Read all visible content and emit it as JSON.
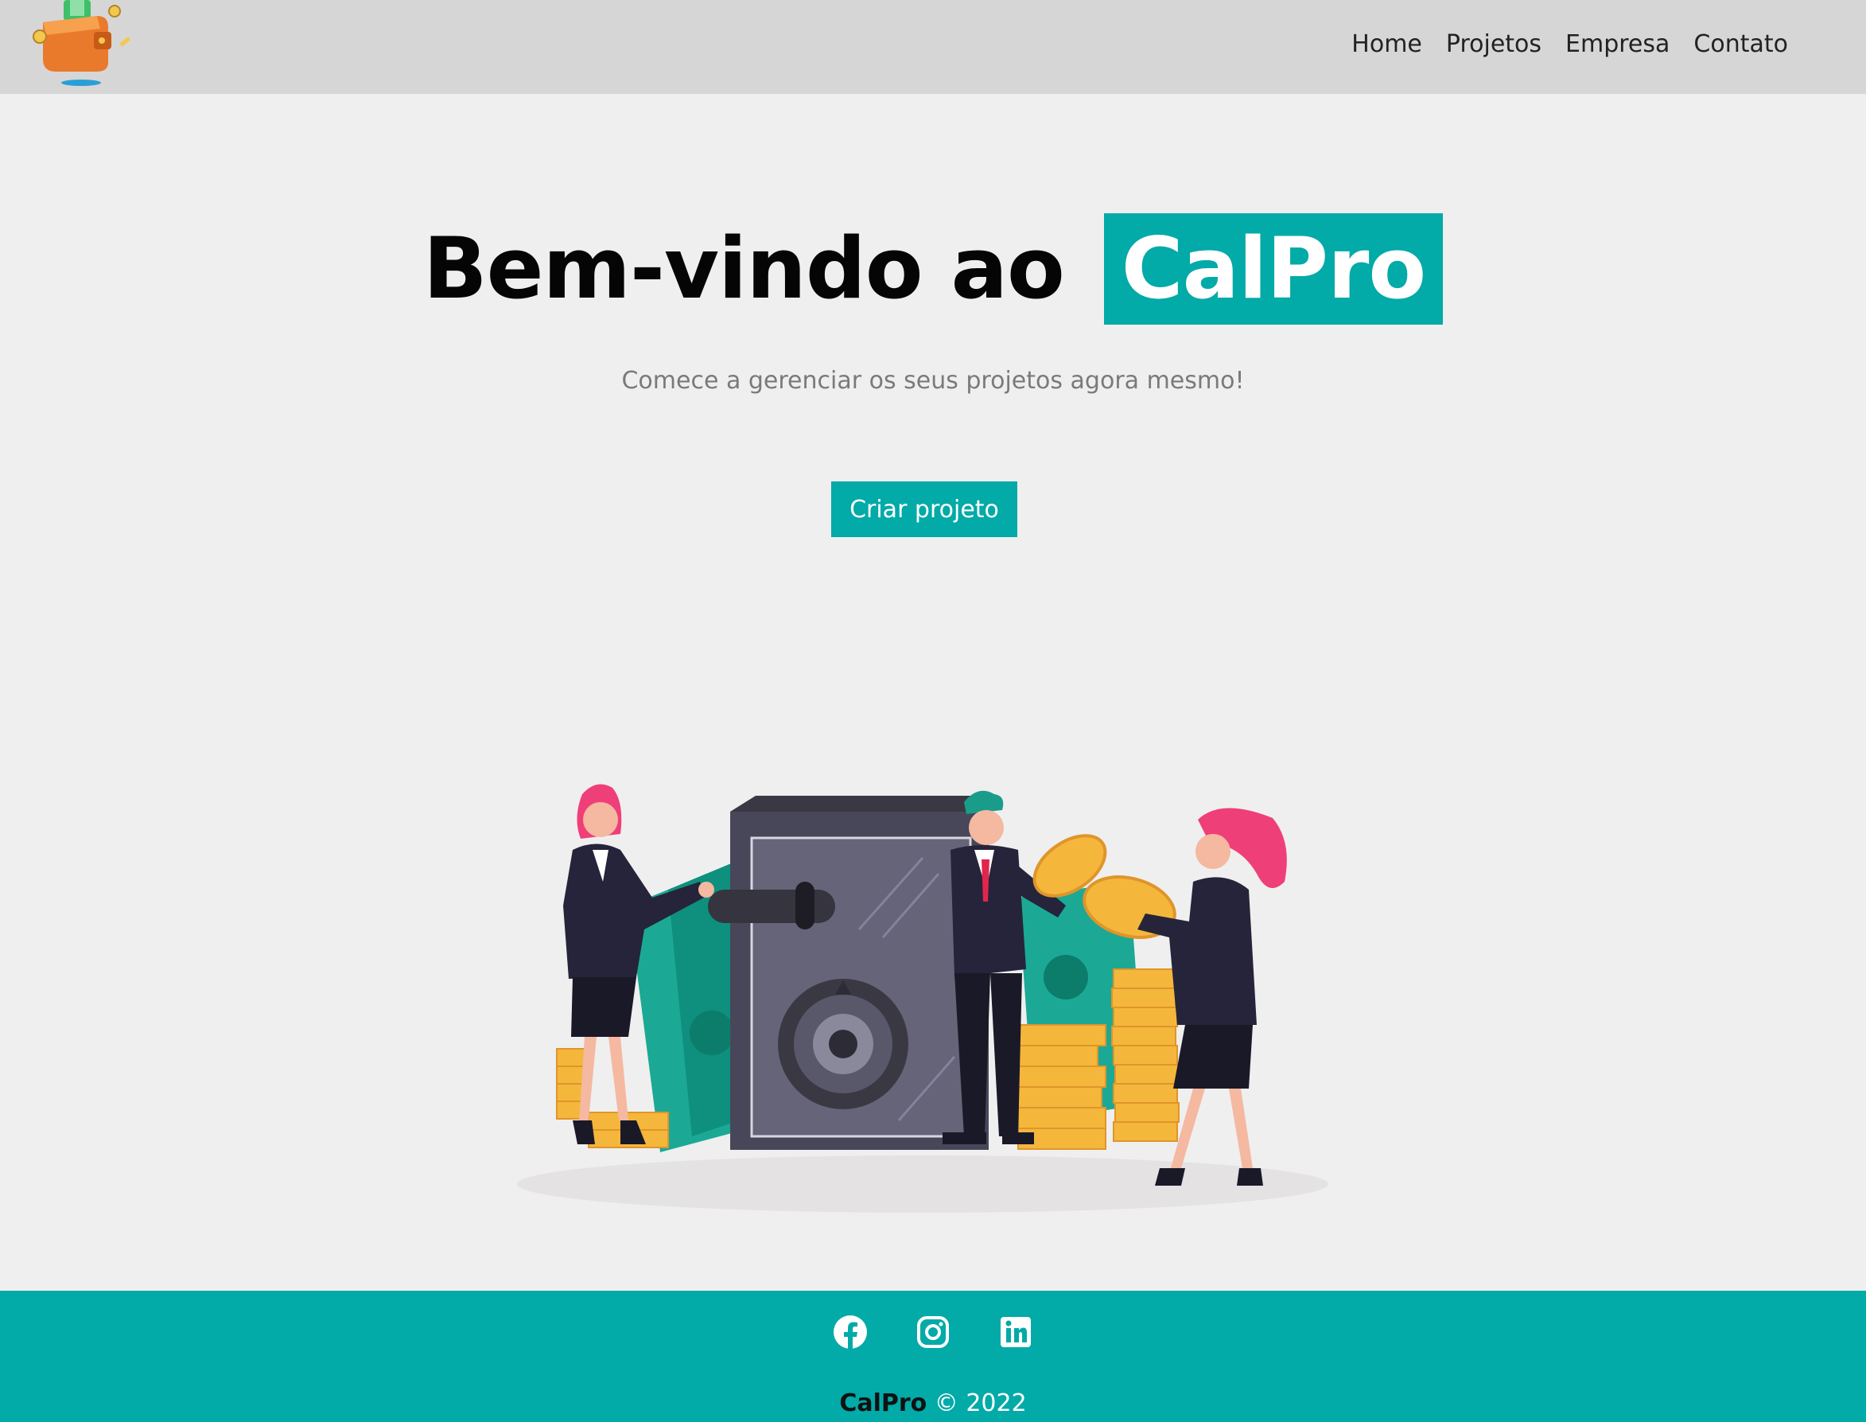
{
  "nav": {
    "links": [
      "Home",
      "Projetos",
      "Empresa",
      "Contato"
    ]
  },
  "hero": {
    "title_prefix": "Bem-vindo ao",
    "title_brand": "CalPro",
    "subtitle": "Comece a gerenciar os seus projetos agora mesmo!",
    "cta_label": "Criar projeto"
  },
  "footer": {
    "brand": "CalPro",
    "copyright": "© 2022",
    "social_icons": [
      "facebook-icon",
      "instagram-icon",
      "linkedin-icon"
    ]
  },
  "colors": {
    "accent": "#02aaa8",
    "navbar": "#d6d6d6",
    "background": "#efefef"
  }
}
